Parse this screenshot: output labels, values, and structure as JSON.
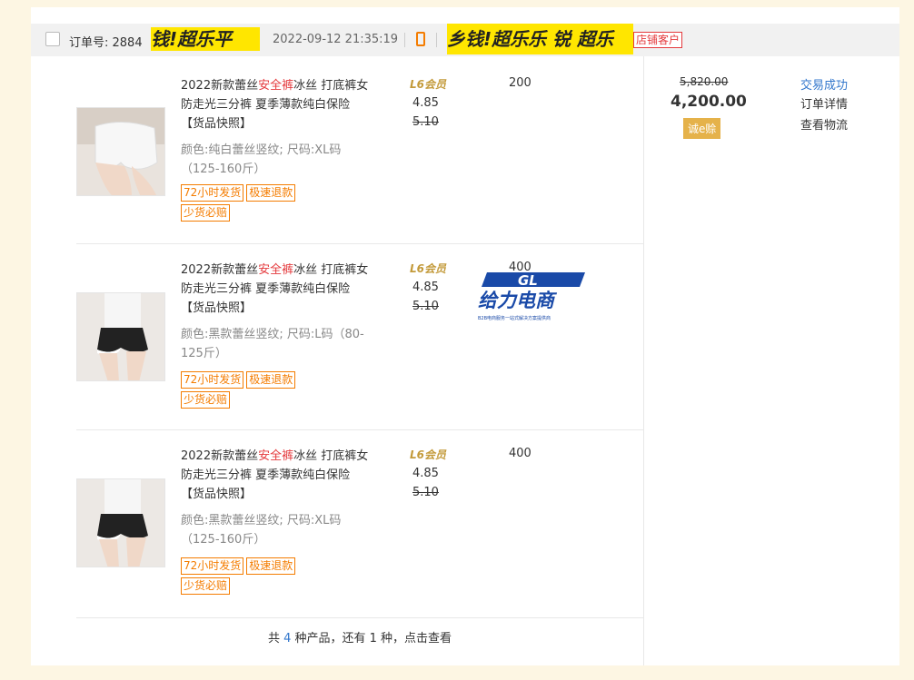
{
  "order": {
    "label": "订单号: 2884",
    "date": "2022-09-12 21:35:19",
    "tag_store": "店铺客户",
    "watermark_1": "钱!超乐平",
    "watermark_2": "乡钱!超乐乐 锐 超乐"
  },
  "items": [
    {
      "title_a": "2022新款蕾丝",
      "title_red": "安全裤",
      "title_b": "冰丝 打底裤女防走光三分裤 夏季薄款纯白保险 【货品快照】",
      "variant": "颜色:纯白蕾丝竖纹; 尺码:XL码（125-160斤）",
      "badges": [
        "72小时发货",
        "极速退款",
        "少货必赔"
      ],
      "level": "L6会员",
      "price": "4.85",
      "orig_price": "5.10",
      "qty": "200"
    },
    {
      "title_a": "2022新款蕾丝",
      "title_red": "安全裤",
      "title_b": "冰丝 打底裤女防走光三分裤 夏季薄款纯白保险 【货品快照】",
      "variant": "颜色:黑款蕾丝竖纹; 尺码:L码（80-125斤）",
      "badges": [
        "72小时发货",
        "极速退款",
        "少货必赔"
      ],
      "level": "L6会员",
      "price": "4.85",
      "orig_price": "5.10",
      "qty": "400"
    },
    {
      "title_a": "2022新款蕾丝",
      "title_red": "安全裤",
      "title_b": "冰丝 打底裤女防走光三分裤 夏季薄款纯白保险 【货品快照】",
      "variant": "颜色:黑款蕾丝竖纹; 尺码:XL码（125-160斤）",
      "badges": [
        "72小时发货",
        "极速退款",
        "少货必赔"
      ],
      "level": "L6会员",
      "price": "4.85",
      "orig_price": "5.10",
      "qty": "400"
    }
  ],
  "summary": {
    "total_old": "5,820.00",
    "total": "4,200.00",
    "pay_badge": "诚e赊",
    "status": "交易成功",
    "link_detail": "订单详情",
    "link_logistics": "查看物流"
  },
  "footer": {
    "prefix": "共 ",
    "count": "4",
    "suffix": " 种产品，还有 1 种，点击查看"
  },
  "logo": {
    "mark": "GL",
    "name": "给力电商",
    "tagline": "B2B电商服务一站式解决方案提供商"
  },
  "colors": {
    "accent_red": "#e4393c",
    "badge_orange": "#f47c00",
    "link_blue": "#3377cc",
    "pay_gold": "#e5b24a"
  }
}
